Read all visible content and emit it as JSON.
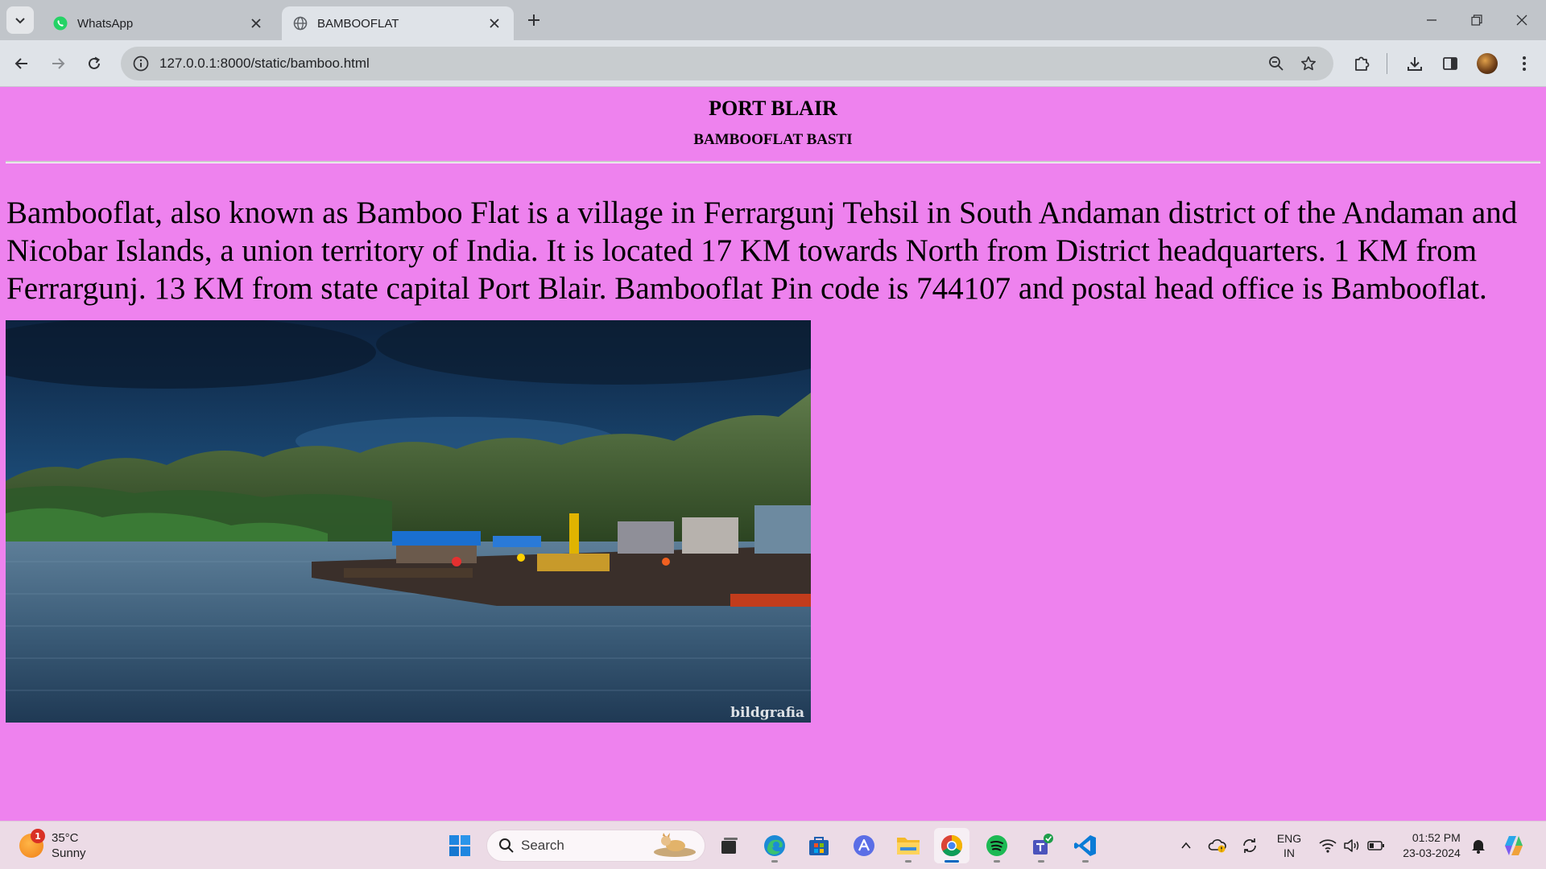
{
  "browser": {
    "tabs": [
      {
        "title": "WhatsApp",
        "icon": "whatsapp-icon",
        "active": false
      },
      {
        "title": "BAMBOOFLAT",
        "icon": "globe-icon",
        "active": true
      }
    ],
    "url": "127.0.0.1:8000/static/bamboo.html"
  },
  "page": {
    "heading": "PORT BLAIR",
    "subheading": "BAMBOOFLAT BASTI",
    "paragraph": "Bambooflat, also known as Bamboo Flat is a village in Ferrargunj Tehsil in South Andaman district of the Andaman and Nicobar Islands, a union territory of India. It is located 17 KM towards North from District headquarters. 1 KM from Ferrargunj. 13 KM from state capital Port Blair. Bambooflat Pin code is 744107 and postal head office is Bambooflat.",
    "image_watermark": "bildgrafia",
    "background_color": "#ee82ee"
  },
  "taskbar": {
    "weather": {
      "temp": "35°C",
      "condition": "Sunny",
      "badge": "1"
    },
    "search_label": "Search",
    "language": {
      "line1": "ENG",
      "line2": "IN"
    },
    "clock": {
      "time": "01:52 PM",
      "date": "23-03-2024"
    }
  }
}
